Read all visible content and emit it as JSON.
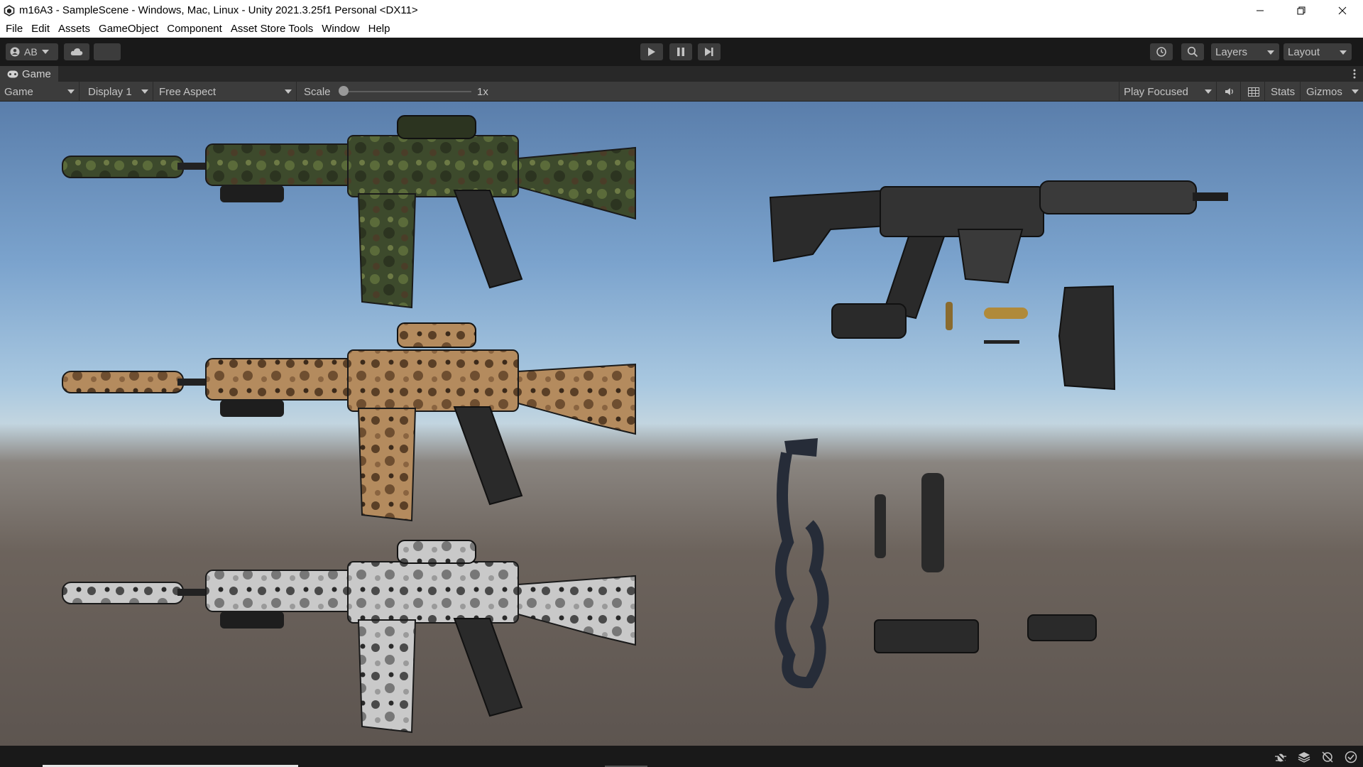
{
  "window": {
    "title": "m16A3 - SampleScene - Windows, Mac, Linux - Unity 2021.3.25f1 Personal <DX11>"
  },
  "menu": [
    "File",
    "Edit",
    "Assets",
    "GameObject",
    "Component",
    "Asset Store Tools",
    "Window",
    "Help"
  ],
  "toolbar": {
    "account_label": "AB",
    "layers_label": "Layers",
    "layout_label": "Layout"
  },
  "tab": {
    "label": "Game"
  },
  "game_view": {
    "mode": "Game",
    "display": "Display 1",
    "aspect": "Free Aspect",
    "scale_label": "Scale",
    "scale_value": "1x",
    "play_mode": "Play Focused",
    "stats_label": "Stats",
    "gizmos_label": "Gizmos"
  },
  "icons": {
    "account": "account-icon",
    "cloud": "cloud-icon",
    "play": "play-icon",
    "pause": "pause-icon",
    "step": "step-icon",
    "history": "history-icon",
    "search": "search-icon",
    "more": "more-options-icon",
    "gamepad": "gamepad-icon",
    "audio": "audio-icon",
    "grid": "grid-icon"
  },
  "colors": {
    "editor_bg": "#191919",
    "panel_bg": "#3c3c3c",
    "text": "#c4c4c4",
    "sky_top": "#5a7eab",
    "ground": "#5d5550"
  }
}
